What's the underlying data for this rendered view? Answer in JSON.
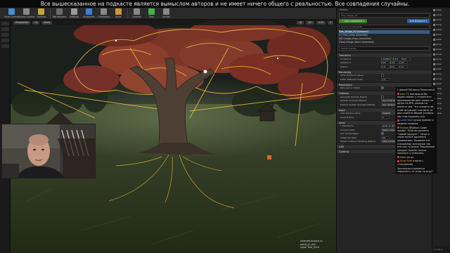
{
  "caption": "Все вышесказанное на подкасте является вымыслом авторов и не имеет ничего общего с реальностью. Все совпадения случайны.",
  "toolbar": {
    "buttons": [
      {
        "label": "Save Current",
        "icon": "save-icon",
        "color": "#4a8bd6"
      },
      {
        "label": "Source Control",
        "icon": "source-control-icon",
        "color": "#888888"
      },
      {
        "label": "Content",
        "icon": "content-icon",
        "color": "#c9a23b"
      },
      {
        "label": "Marketplace",
        "icon": "marketplace-icon",
        "color": "#6c6c6c"
      },
      {
        "label": "Settings",
        "icon": "gear-icon",
        "color": "#9a9a9a"
      },
      {
        "label": "Blueprints",
        "icon": "blueprints-icon",
        "color": "#3d7fd1"
      },
      {
        "label": "Cinematics",
        "icon": "cinematics-icon",
        "color": "#888888"
      },
      {
        "label": "Build",
        "icon": "build-icon",
        "color": "#c99a3b"
      },
      {
        "label": "Compile",
        "icon": "compile-icon",
        "color": "#888888"
      },
      {
        "label": "Play",
        "icon": "play-icon",
        "color": "#4ab04a"
      },
      {
        "label": "Launch",
        "icon": "launch-icon",
        "color": "#888888"
      }
    ]
  },
  "viewport": {
    "chips": [
      "Perspective",
      "Lit",
      "Show"
    ],
    "chips_right": [
      "10",
      "10°",
      "0.25",
      "4"
    ],
    "selected_info": [
      "Selected Actor(s) in:",
      "world_v2_stl2",
      "Level: Tree_V2Lit"
    ]
  },
  "outliner": {
    "tab": "Details",
    "actor_name": "Tree_Village_A3",
    "add_component": "+ Add Component ▾",
    "edit_blueprint": "Edit Blueprint ▾",
    "search_placeholder": "Search Components",
    "tree": [
      "Tree_Village_A3 (Instance)",
      "  [+] Oak_Lamp (Inherited)",
      "    [M] Foliage_Proxy (Inherited)",
      "    [Tree] Village_Bark3 (Inherited)"
    ],
    "tree_selected_index": 0,
    "details_search": "Search Details"
  },
  "details": {
    "categories": [
      {
        "name": "Transform",
        "props": [
          {
            "name": "Location ▾",
            "type": "vec",
            "values": [
              "-14750.0",
              "-9.0",
              "0.0"
            ]
          },
          {
            "name": "Rotation ▾",
            "type": "vec",
            "values": [
              "0.0°",
              "0.0°",
              "0.0°"
            ]
          },
          {
            "name": "Scale ▾",
            "type": "vec",
            "values": [
              "1.0",
              "1.0",
              "1.0"
            ]
          }
        ]
      },
      {
        "name": "Rendering",
        "props": [
          {
            "name": "Actor Hidden In Game",
            "type": "check",
            "on": false
          },
          {
            "name": "Editor Billboard Scale",
            "type": "text",
            "value": "1.0"
          }
        ]
      },
      {
        "name": "Replication",
        "props": [
          {
            "name": "Net Load on Client",
            "type": "check",
            "on": true
          }
        ]
      },
      {
        "name": "Collision",
        "props": [
          {
            "name": "Generate Overlap Events",
            "type": "check",
            "on": false
          },
          {
            "name": "Update Overlaps Method",
            "type": "drop",
            "value": "Use Config Default"
          },
          {
            "name": "Default Update Overlaps Method",
            "type": "drop",
            "value": "Only Update Movable"
          }
        ]
      },
      {
        "name": "Input",
        "props": [
          {
            "name": "Auto Receive Input",
            "type": "drop",
            "value": "Disabled"
          },
          {
            "name": "Input Priority",
            "type": "text",
            "value": "0"
          }
        ]
      },
      {
        "name": "Actor",
        "props": [
          {
            "name": "1 selected in",
            "type": "text",
            "value": "world_v2_stl2"
          },
          {
            "name": "Convert Actor",
            "type": "drop",
            "value": "Select a Type"
          },
          {
            "name": "Can be Damaged",
            "type": "check",
            "on": true
          },
          {
            "name": "Initial Life Span",
            "type": "text",
            "value": "0.0"
          },
          {
            "name": "Spawn Collision Handling Method",
            "type": "drop",
            "value": "Always Spawn, Ignore"
          }
        ]
      },
      {
        "name": "LOD",
        "props": []
      },
      {
        "name": "Cooking",
        "props": []
      }
    ]
  },
  "world_outliner": {
    "rows": [
      "Label",
      "Lamp",
      "Lamp",
      "Lamp",
      "Label",
      "Label",
      "Label",
      "Lamp",
      "Label",
      "Lamp",
      "Lamp",
      "Label",
      "Label",
      "Lamp",
      "Lamp",
      "Label",
      "Label",
      "Lamp",
      "Label",
      "Lamp",
      "Lamp",
      "Label"
    ]
  },
  "chat": {
    "messages": [
      {
        "user": "",
        "color": "",
        "text": "с фицей EXLiberal Ренессанса"
      },
      {
        "user": "Ironi TV",
        "color": "",
        "text": "мнгарасно бы видео сейчас у стороннего производства вахт какие на ветке на 8TK, режим на впите в чем. Что скажете об этой ситуации? считаете ли два клиента общем условии как ним спросить эти"
      },
      {
        "user": "Lords Sect",
        "color": "b",
        "text": "лучше времен и модели начиная"
      },
      {
        "user": "Mallow",
        "color": "g",
        "text": "@Sailors Сaфe привет. Если вы делаете \"новый продукт\", тогда и перестаньте высмеять проверками. Надоели это (например) жетинуюя так или как то иначе. Рекламный продукт можно только показать и отменять"
      },
      {
        "user": "Miles",
        "color": "",
        "text": "ее по"
      },
      {
        "user": "Krow Rust",
        "color": "o",
        "text": "отойти ( сгнотрений)"
      },
      {
        "user": "",
        "color": "",
        "text": "Экспансия стремится серьезно к от игры на игру?"
      },
      {
        "user": "Tigir Coos",
        "color": "b",
        "text": "Олойтнуг ) [ K&FT] из того попадались в UE4] и присоединять новые места в UE4 )))"
      }
    ]
  },
  "status": "1.23.8 /3"
}
